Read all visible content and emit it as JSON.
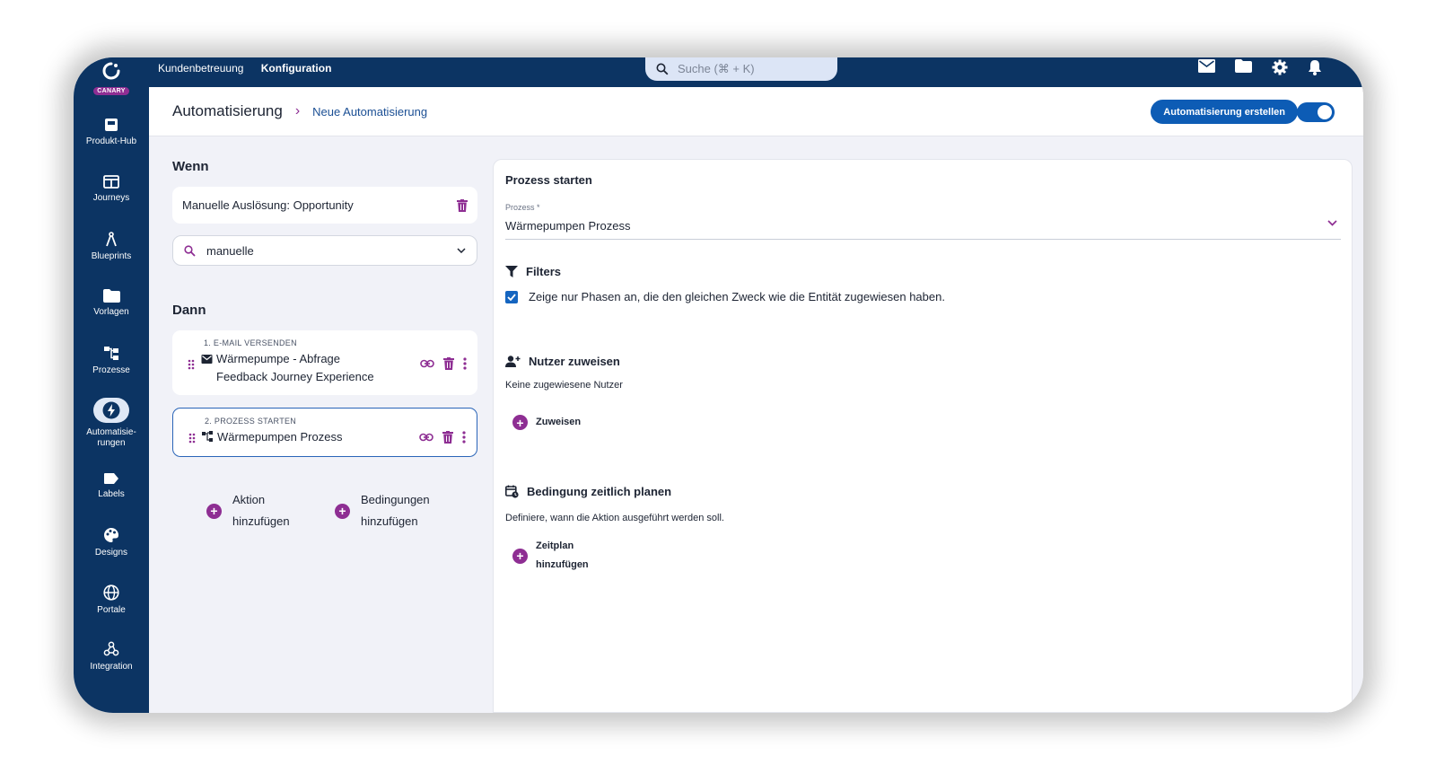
{
  "app": {
    "badge": "CANARY"
  },
  "topnav": {
    "tabs": [
      {
        "label": "Kundenbetreuung"
      },
      {
        "label": "Konfiguration"
      }
    ],
    "search_placeholder": "Suche (⌘ + K)",
    "icons": [
      "mail-icon",
      "folder-icon",
      "settings-icon",
      "bell-icon"
    ]
  },
  "sidebar": {
    "items": [
      {
        "label": "Produkt-Hub",
        "icon": "product-hub-icon"
      },
      {
        "label": "Journeys",
        "icon": "journeys-icon"
      },
      {
        "label": "Blueprints",
        "icon": "compass-icon"
      },
      {
        "label": "Vorlagen",
        "icon": "folder-icon"
      },
      {
        "label": "Prozesse",
        "icon": "process-icon"
      },
      {
        "label": "Automatisie-",
        "label2": "rungen",
        "icon": "bolt-icon",
        "active": true
      },
      {
        "label": "Labels",
        "icon": "label-icon"
      },
      {
        "label": "Designs",
        "icon": "palette-icon"
      },
      {
        "label": "Portale",
        "icon": "globe-icon"
      },
      {
        "label": "Integration",
        "icon": "webhook-icon"
      }
    ]
  },
  "header": {
    "breadcrumb_root": "Automatisierung",
    "breadcrumb_child": "Neue Automatisierung",
    "create_button": "Automatisierung erstellen",
    "toggle_on": true
  },
  "left": {
    "when_title": "Wenn",
    "trigger_label": "Manuelle Auslösung: Opportunity",
    "search_value": "manuelle",
    "then_title": "Dann",
    "actions": [
      {
        "step": "1. E-MAIL VERSENDEN",
        "line1": "Wärmepumpe - Abfrage",
        "line2": "Feedback Journey Experience",
        "type_icon": "mail-icon"
      },
      {
        "step": "2. PROZESS STARTEN",
        "line1": "Wärmepumpen Prozess",
        "type_icon": "process-icon",
        "selected": true
      }
    ],
    "add_action": {
      "line1": "Aktion",
      "line2": "hinzufügen"
    },
    "add_condition": {
      "line1": "Bedingungen",
      "line2": "hinzufügen"
    }
  },
  "panel": {
    "title": "Prozess starten",
    "process_label": "Prozess *",
    "process_value": "Wärmepumpen Prozess",
    "filters_title": "Filters",
    "filter_checkbox": "Zeige nur Phasen an, die den gleichen Zweck wie die Entität zugewiesen haben.",
    "filter_checked": true,
    "assign_title": "Nutzer zuweisen",
    "assign_empty": "Keine zugewiesene Nutzer",
    "assign_button": "Zuweisen",
    "schedule_title": "Bedingung zeitlich planen",
    "schedule_desc": "Definiere, wann die Aktion ausgeführt werden soll.",
    "schedule_button_line1": "Zeitplan",
    "schedule_button_line2": "hinzufügen"
  },
  "colors": {
    "navy": "#0c3463",
    "accent_purple": "#8e2e93",
    "primary_blue": "#0d5cb5"
  }
}
